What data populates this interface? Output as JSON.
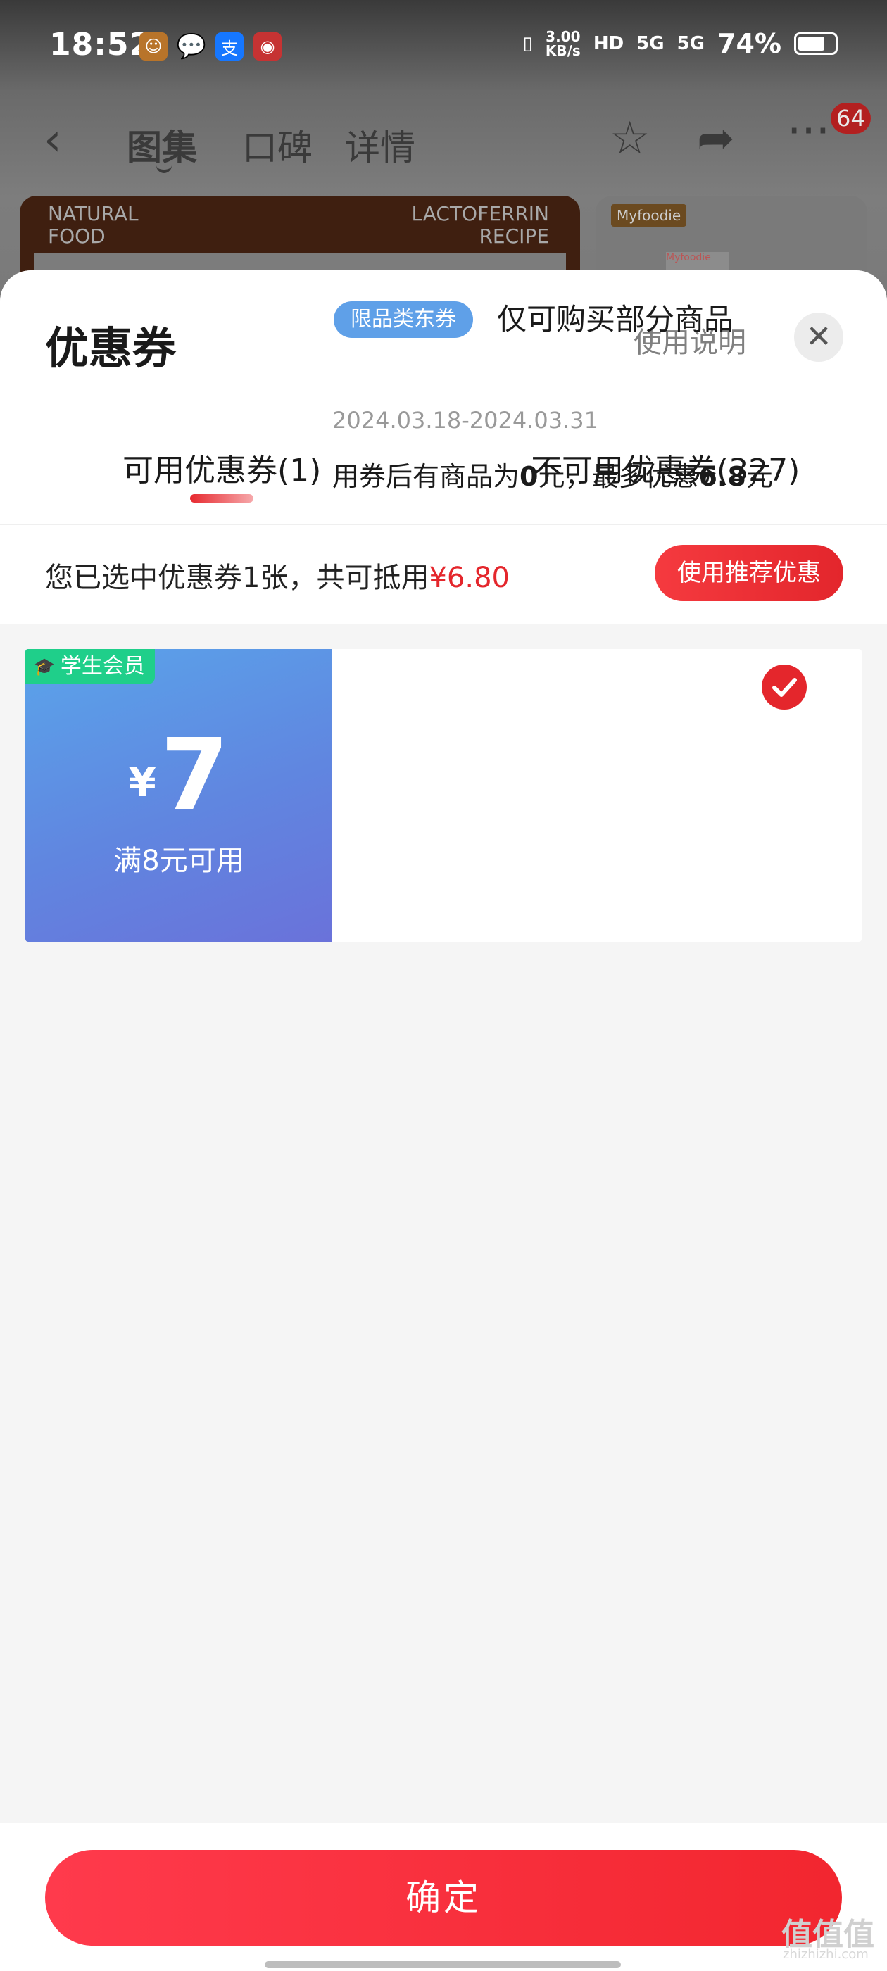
{
  "status_bar": {
    "time": "18:52",
    "net_speed_value": "3.00",
    "net_speed_unit": "KB/s",
    "hd_label": "HD",
    "sim1": "5G",
    "sim2": "5G",
    "battery_percent": "74%",
    "battery_level": 0.74
  },
  "nav": {
    "tabs": [
      "图集",
      "口碑",
      "详情"
    ],
    "active_tab": 0,
    "badge_count": "64"
  },
  "background_product": {
    "left_text": "NATURAL\nFOOD",
    "right_text": "LACTOFERRIN\nRECIPE",
    "logo_text": "Myfoodie",
    "mini_label": "Myfoodie"
  },
  "sheet": {
    "title": "优惠券",
    "usage_link": "使用说明",
    "close_glyph": "✕",
    "tabs": {
      "available": "可用优惠券(1)",
      "unavailable": "不可用优惠券(327)"
    },
    "summary": {
      "prefix": "您已选中优惠券1张，共可抵用",
      "amount": "¥6.80"
    },
    "recommend_button": "使用推荐优惠"
  },
  "coupon": {
    "member_badge": "学生会员",
    "currency": "¥",
    "value": "7",
    "threshold": "满8元可用",
    "tag": "限品类东券",
    "scope": "仅可购买部分商品",
    "date_range": "2024.03.18-2024.03.31",
    "desc_a": "用券后有商品为",
    "desc_b": "0",
    "desc_c": "元，最多优惠",
    "desc_d": "6.8",
    "desc_e": "元",
    "selected": true
  },
  "footer": {
    "confirm_button": "确定"
  },
  "watermark": {
    "main": "值值值",
    "sub": "zhizhizhi.com"
  },
  "colors": {
    "accent_red": "#e4262c",
    "coupon_blue": "#6086e0",
    "member_green": "#1fcf8a"
  }
}
